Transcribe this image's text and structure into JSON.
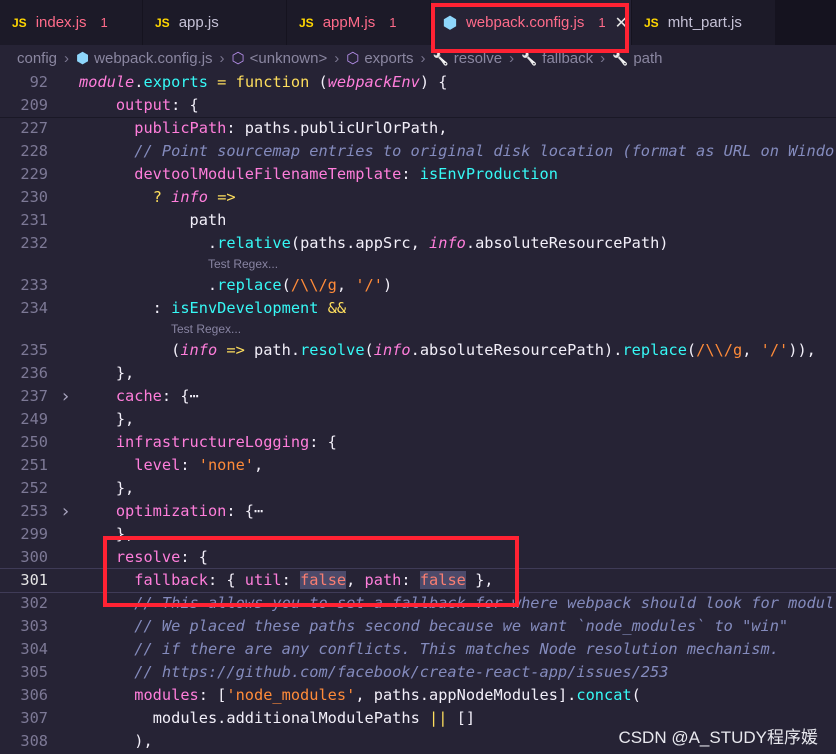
{
  "tabs": [
    {
      "icon": "JS",
      "label": "index.js",
      "badge": "1",
      "status": "error"
    },
    {
      "icon": "JS",
      "label": "app.js",
      "badge": "",
      "status": "normal"
    },
    {
      "icon": "JS",
      "label": "appM.js",
      "badge": "1",
      "status": "error"
    },
    {
      "icon": "webpack-icon",
      "label": "webpack.config.js",
      "badge": "1",
      "status": "error",
      "active": true,
      "close": "✕"
    },
    {
      "icon": "JS",
      "label": "mht_part.js",
      "badge": "",
      "status": "normal"
    }
  ],
  "breadcrumb": [
    "config",
    "webpack.config.js",
    "<unknown>",
    "exports",
    "resolve",
    "fallback",
    "path"
  ],
  "code_lines": [
    {
      "num": "92",
      "text": "module.exports = function (webpackEnv) {",
      "sticky": true
    },
    {
      "num": "209",
      "text": "    output: {",
      "sticky": true
    },
    {
      "num": "227",
      "text": "      publicPath: paths.publicUrlOrPath,"
    },
    {
      "num": "228",
      "text": "      // Point sourcemap entries to original disk location (format as URL on Windo"
    },
    {
      "num": "229",
      "text": "      devtoolModuleFilenameTemplate: isEnvProduction"
    },
    {
      "num": "230",
      "text": "        ? info =>"
    },
    {
      "num": "231",
      "text": "            path"
    },
    {
      "num": "232",
      "text": "              .relative(paths.appSrc, info.absoluteResourcePath)"
    },
    {
      "num": "233",
      "text": "              .replace(/\\\\/g, '/')"
    },
    {
      "num": "234",
      "text": "        : isEnvDevelopment &&"
    },
    {
      "num": "235",
      "text": "          (info => path.resolve(info.absoluteResourcePath).replace(/\\\\/g, '/')),"
    },
    {
      "num": "236",
      "text": "    },"
    },
    {
      "num": "237",
      "text": "    cache: {⋯",
      "fold": true
    },
    {
      "num": "249",
      "text": "    },"
    },
    {
      "num": "250",
      "text": "    infrastructureLogging: {"
    },
    {
      "num": "251",
      "text": "      level: 'none',"
    },
    {
      "num": "252",
      "text": "    },"
    },
    {
      "num": "253",
      "text": "    optimization: {⋯",
      "fold": true
    },
    {
      "num": "299",
      "text": "    },"
    },
    {
      "num": "300",
      "text": "    resolve: {"
    },
    {
      "num": "301",
      "text": "      fallback: { util: false, path: false },",
      "current": true
    },
    {
      "num": "302",
      "text": "      // This allows you to set a fallback for where webpack should look for modul"
    },
    {
      "num": "303",
      "text": "      // We placed these paths second because we want `node_modules` to \"win\""
    },
    {
      "num": "304",
      "text": "      // if there are any conflicts. This matches Node resolution mechanism."
    },
    {
      "num": "305",
      "text": "      // https://github.com/facebook/create-react-app/issues/253"
    },
    {
      "num": "306",
      "text": "      modules: ['node_modules', paths.appNodeModules].concat("
    },
    {
      "num": "307",
      "text": "        modules.additionalModulePaths || []"
    },
    {
      "num": "308",
      "text": "      ),"
    }
  ],
  "hints": [
    {
      "after": "232",
      "label": "Test Regex..."
    },
    {
      "after": "234",
      "label": "Test Regex..."
    }
  ],
  "watermark": "CSDN @A_STUDY程序媛",
  "colors": {
    "editor_bg": "#262335",
    "keyword": "#fede5d",
    "property": "#ff7edb",
    "function": "#36f9f6",
    "string": "#ff8b39",
    "comment": "#848bbd",
    "boolean": "#f97e72",
    "annotation_box": "#ff2233"
  }
}
